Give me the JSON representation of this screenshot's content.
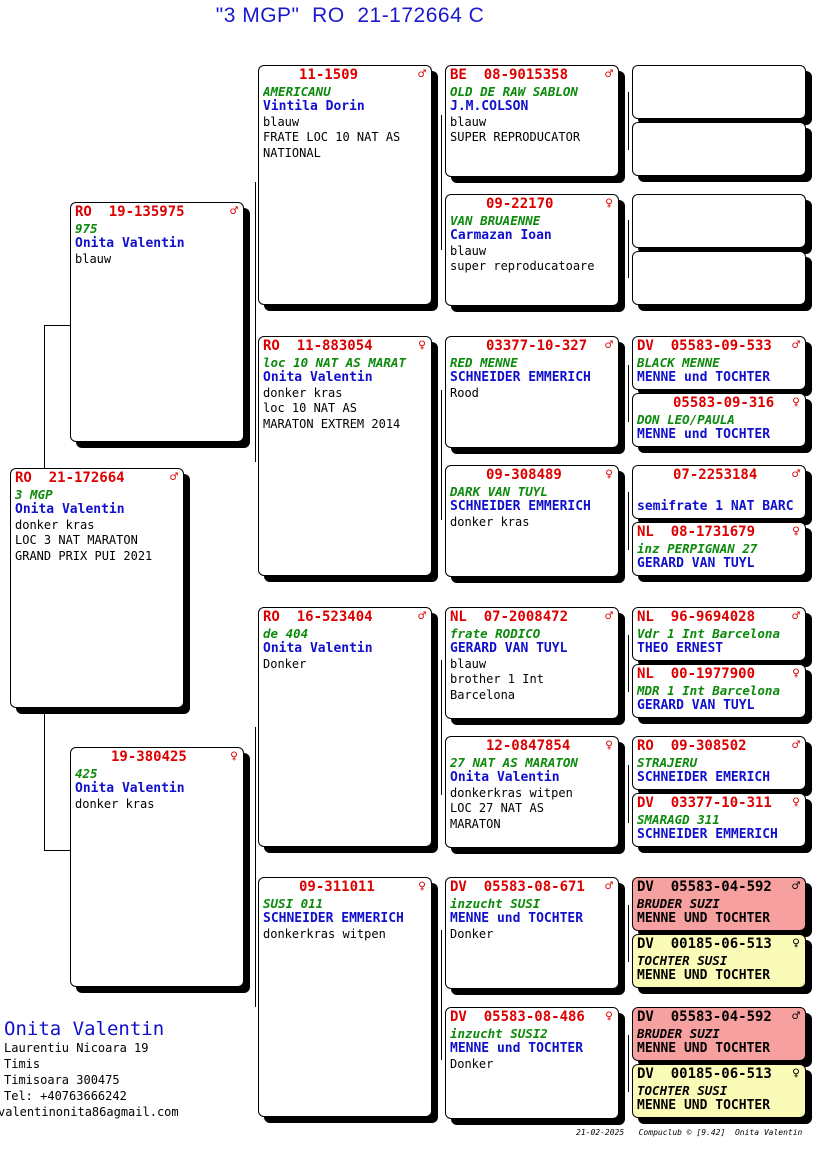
{
  "title": "\"3 MGP\"  RO  21-172664 C",
  "subject": {
    "ring": "RO  21-172664",
    "sex": "♂",
    "name": "3 MGP",
    "owner": "Onita Valentin",
    "lines": [
      "donker kras",
      "LOC 3 NAT MARATON",
      "GRAND PRIX PUI 2021"
    ]
  },
  "father": {
    "ring": "RO  19-135975",
    "sex": "♂",
    "name": "975",
    "owner": "Onita Valentin",
    "lines": [
      "blauw"
    ]
  },
  "mother": {
    "ring": "19-380425",
    "sex": "♀",
    "name": "425",
    "owner": "Onita Valentin",
    "lines": [
      "donker kras"
    ]
  },
  "g2": [
    {
      "ring": "11-1509",
      "sex": "♂",
      "name": "AMERICANU",
      "owner": "Vintila Dorin",
      "lines": [
        "blauw",
        "FRATE LOC 10 NAT AS",
        "NATIONAL"
      ]
    },
    {
      "ring": "RO  11-883054",
      "sex": "♀",
      "name": "loc 10 NAT AS MARAT",
      "owner": "Onita Valentin",
      "lines": [
        "donker kras",
        "loc 10 NAT AS",
        "MARATON EXTREM 2014"
      ]
    },
    {
      "ring": "RO  16-523404",
      "sex": "♂",
      "name": "de 404",
      "owner": "Onita Valentin",
      "lines": [
        "Donker"
      ]
    },
    {
      "ring": "09-311011",
      "sex": "♀",
      "name": "SUSI 011",
      "owner": "SCHNEIDER EMMERICH",
      "lines": [
        "donkerkras witpen"
      ]
    }
  ],
  "g3": [
    {
      "ring": "BE  08-9015358",
      "sex": "♂",
      "name": "OLD DE RAW SABLON",
      "owner": "J.M.COLSON",
      "lines": [
        "blauw",
        "SUPER REPRODUCATOR"
      ]
    },
    {
      "ring": "09-22170",
      "sex": "♀",
      "name": "VAN BRUAENNE",
      "owner": "Carmazan Ioan",
      "lines": [
        "blauw",
        "super reproducatoare"
      ]
    },
    {
      "ring": "03377-10-327",
      "sex": "♂",
      "name": "RED MENNE",
      "owner": "SCHNEIDER EMMERICH",
      "lines": [
        "Rood"
      ]
    },
    {
      "ring": "09-308489",
      "sex": "♀",
      "name": "DARK VAN TUYL",
      "owner": "SCHNEIDER EMMERICH",
      "lines": [
        "donker kras"
      ]
    },
    {
      "ring": "NL  07-2008472",
      "sex": "♂",
      "name": "frate RODICO",
      "owner": "GERARD VAN TUYL",
      "lines": [
        "blauw",
        "brother 1 Int",
        "Barcelona"
      ]
    },
    {
      "ring": "12-0847854",
      "sex": "♀",
      "name": "27 NAT AS MARATON",
      "owner": "Onita Valentin",
      "lines": [
        "donkerkras witpen",
        "LOC 27 NAT AS",
        "MARATON"
      ]
    },
    {
      "ring": "DV  05583-08-671",
      "sex": "♂",
      "name": "inzucht SUSI",
      "owner": "MENNE und TOCHTER",
      "lines": [
        "Donker"
      ]
    },
    {
      "ring": "DV  05583-08-486",
      "sex": "♀",
      "name": "inzucht SUSI2",
      "owner": "MENNE und TOCHTER",
      "lines": [
        "Donker"
      ]
    }
  ],
  "g4": [
    {
      "ring": "",
      "sex": "",
      "name": "",
      "owner": ""
    },
    {
      "ring": "",
      "sex": "",
      "name": "",
      "owner": ""
    },
    {
      "ring": "",
      "sex": "",
      "name": "",
      "owner": ""
    },
    {
      "ring": "",
      "sex": "",
      "name": "",
      "owner": ""
    },
    {
      "ring": "DV  05583-09-533",
      "sex": "♂",
      "name": "BLACK MENNE",
      "owner": "MENNE und TOCHTER"
    },
    {
      "ring": "05583-09-316",
      "sex": "♀",
      "name": "DON LEO/PAULA",
      "owner": "MENNE und TOCHTER"
    },
    {
      "ring": "07-2253184",
      "sex": "♂",
      "name": "",
      "owner": "semifrate 1 NAT BARC"
    },
    {
      "ring": "NL  08-1731679",
      "sex": "♀",
      "name": "inz PERPIGNAN 27",
      "owner": "GERARD VAN TUYL"
    },
    {
      "ring": "NL  96-9694028",
      "sex": "♂",
      "name": "Vdr 1 Int Barcelona",
      "owner": "THEO ERNEST"
    },
    {
      "ring": "NL  00-1977900",
      "sex": "♀",
      "name": "MDR 1 Int Barcelona",
      "owner": "GERARD VAN TUYL"
    },
    {
      "ring": "RO  09-308502",
      "sex": "♂",
      "name": "STRAJERU",
      "owner": "SCHNEIDER EMERICH"
    },
    {
      "ring": "DV  03377-10-311",
      "sex": "♀",
      "name": "SMARAGD 311",
      "owner": "SCHNEIDER EMMERICH"
    },
    {
      "ring": "DV  05583-04-592",
      "sex": "♂",
      "name": "BRUDER SUZI",
      "owner": "MENNE UND TOCHTER"
    },
    {
      "ring": "DV  00185-06-513",
      "sex": "♀",
      "name": "TOCHTER SUSI",
      "owner": "MENNE UND TOCHTER"
    },
    {
      "ring": "DV  05583-04-592",
      "sex": "♂",
      "name": "BRUDER SUZI",
      "owner": "MENNE UND TOCHTER"
    },
    {
      "ring": "DV  00185-06-513",
      "sex": "♀",
      "name": "TOCHTER SUSI",
      "owner": "MENNE UND TOCHTER"
    }
  ],
  "owner_block": {
    "name": "Onita Valentin",
    "lines": [
      "Laurentiu Nicoara 19",
      "Timis",
      "Timisoara 300475",
      "Tel: +40763666242",
      "valentinonita86agmail.com"
    ]
  },
  "footer": "21-02-2025   Compuclub © [9.42]  Onita Valentin"
}
